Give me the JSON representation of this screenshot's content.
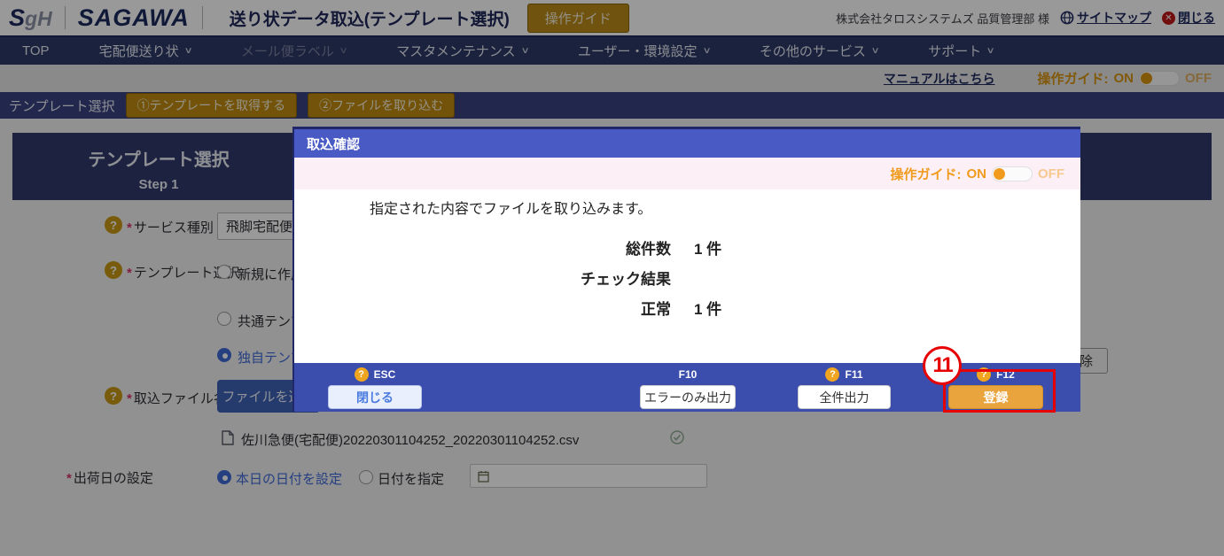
{
  "icons": {
    "chevron": "∨",
    "help": "?",
    "close": "✕",
    "required": "*"
  },
  "colors": {
    "nav_navy": "#2e3a66",
    "breadcrumb_navy": "#3a4480",
    "accent_gold": "#c08a10",
    "modal_title_blue": "#4a5ac4",
    "modal_footer_blue": "#3b4dad",
    "primary_button_orange": "#e9a43e",
    "toggle_orange": "#f09b1e",
    "annotation_red": "#e60202",
    "link_navy": "#1f2a5e",
    "selected_radio_blue": "#3f6ad8"
  },
  "header": {
    "logo": {
      "s": "S",
      "gh": "gH",
      "brand": "SAGAWA"
    },
    "page_title": "送り状データ取込(テンプレート選択)",
    "guide_button": "操作ガイド",
    "user_name": "株式会社タロスシステムズ 品質管理部 様",
    "sitemap_link": "サイトマップ",
    "close_link": "閉じる"
  },
  "nav": {
    "items": [
      {
        "label": "TOP",
        "has_menu": false,
        "disabled": false
      },
      {
        "label": "宅配便送り状",
        "has_menu": true,
        "disabled": false
      },
      {
        "label": "メール便ラベル",
        "has_menu": true,
        "disabled": true
      },
      {
        "label": "マスタメンテナンス",
        "has_menu": true,
        "disabled": false
      },
      {
        "label": "ユーザー・環境設定",
        "has_menu": true,
        "disabled": false
      },
      {
        "label": "その他のサービス",
        "has_menu": true,
        "disabled": false
      },
      {
        "label": "サポート",
        "has_menu": true,
        "disabled": false
      }
    ]
  },
  "toolbar": {
    "manual_link": "マニュアルはこちら",
    "guide_toggle": {
      "label": "操作ガイド:",
      "on": "ON",
      "off": "OFF",
      "state": "ON"
    }
  },
  "breadcrumb": {
    "title": "テンプレート選択",
    "action1": "①テンプレートを取得する",
    "action2": "②ファイルを取り込む"
  },
  "main": {
    "step_header": {
      "title": "テンプレート選択",
      "subtitle": "Step 1"
    },
    "fields": {
      "service_type": {
        "label": "サービス種別",
        "required": true,
        "value": "飛脚宅配便"
      },
      "template_select": {
        "label": "テンプレート選択",
        "required": true,
        "options": [
          {
            "label": "新規に作成",
            "selected": false
          },
          {
            "label": "共通テンプレート",
            "selected": false
          },
          {
            "label": "独自テンプレート",
            "selected": true
          }
        ]
      },
      "import_file": {
        "label": "取込ファイル名称",
        "required": true,
        "button": "ファイルを選択",
        "file_name": "佐川急便(宅配便)20220301104252_20220301104252.csv"
      },
      "ship_date": {
        "label": "出荷日の設定",
        "required": true,
        "options": [
          {
            "label": "本日の日付を設定",
            "selected": true
          },
          {
            "label": "日付を指定",
            "selected": false
          }
        ],
        "date_value": ""
      }
    },
    "delete_button": "削除"
  },
  "modal": {
    "title": "取込確認",
    "guide_toggle": {
      "label": "操作ガイド:",
      "on": "ON",
      "off": "OFF",
      "state": "ON"
    },
    "message": "指定された内容でファイルを取り込みます。",
    "stats": [
      {
        "label": "総件数",
        "value": "1 件"
      },
      {
        "label": "チェック結果",
        "value": ""
      },
      {
        "label": "正常",
        "value": "1 件"
      }
    ],
    "buttons": [
      {
        "key": "ESC",
        "help": true,
        "label": "閉じる",
        "style": "light"
      },
      {
        "key": "F10",
        "help": false,
        "label": "エラーのみ出力",
        "style": "white"
      },
      {
        "key": "F11",
        "help": true,
        "label": "全件出力",
        "style": "white"
      },
      {
        "key": "F12",
        "help": true,
        "label": "登録",
        "style": "primary",
        "annotated": true
      }
    ],
    "annotation": {
      "number": "11"
    }
  }
}
